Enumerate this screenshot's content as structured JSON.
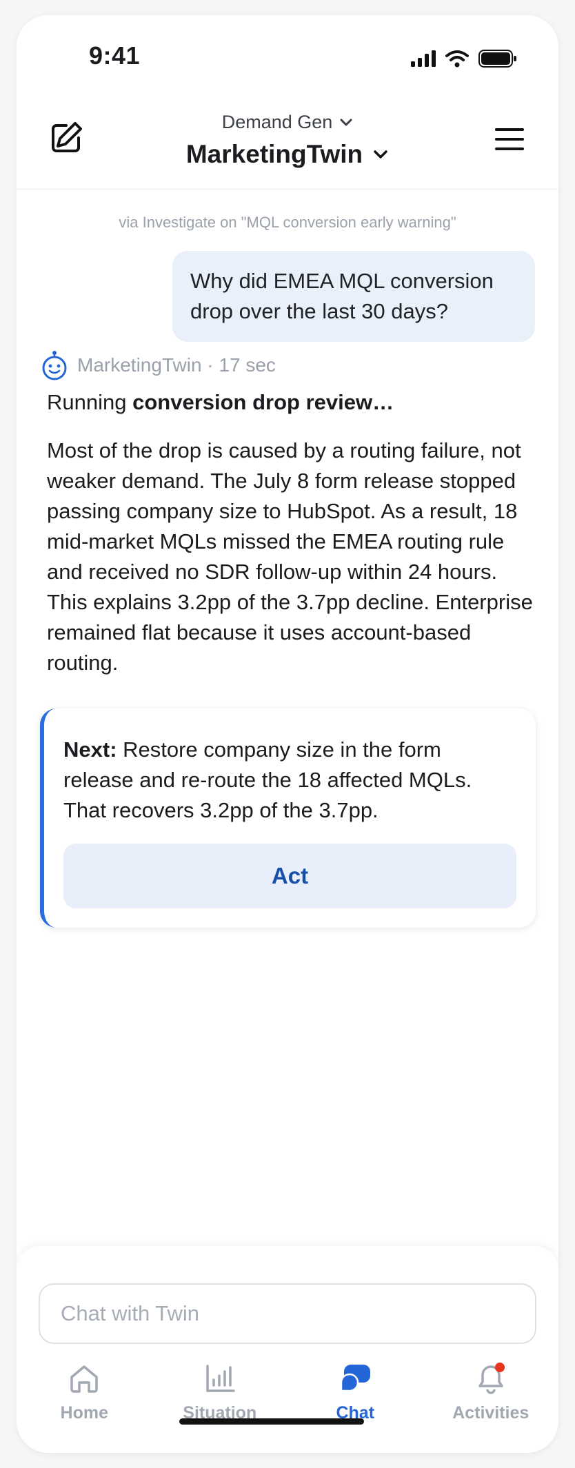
{
  "status_bar": {
    "time": "9:41"
  },
  "header": {
    "workspace": "Demand Gen",
    "title": "MarketingTwin"
  },
  "conversation": {
    "context_note": "via Investigate on \"MQL conversion early warning\"",
    "user_message": "Why did EMEA MQL conversion drop over the last 30 days?",
    "bot": {
      "meta": "MarketingTwin · 17 sec",
      "running_prefix": "Running ",
      "running_task": "conversion drop review…",
      "answer": "Most of the drop is caused by a routing failure, not weaker demand. The July 8 form release stopped passing company size to HubSpot. As a result, 18 mid-market MQLs missed the EMEA routing rule and received no SDR follow-up within 24 hours. This explains 3.2pp of the 3.7pp decline. Enterprise remained flat because it uses account-based routing."
    },
    "next_card": {
      "label": "Next:",
      "text": " Restore company size in the form release and re-route the 18 affected MQLs. That recovers 3.2pp of the 3.7pp.",
      "action_label": "Act"
    }
  },
  "composer": {
    "placeholder": "Chat with Twin"
  },
  "tabbar": {
    "tabs": [
      {
        "label": "Home",
        "icon": "home-icon"
      },
      {
        "label": "Situation",
        "icon": "bar-chart-icon"
      },
      {
        "label": "Chat",
        "icon": "chat-icon"
      },
      {
        "label": "Activities",
        "icon": "bell-icon"
      }
    ],
    "active": "Chat"
  },
  "colors": {
    "accent": "#2466d8",
    "bubble": "#eaf0fa",
    "badge": "#e5361e"
  }
}
